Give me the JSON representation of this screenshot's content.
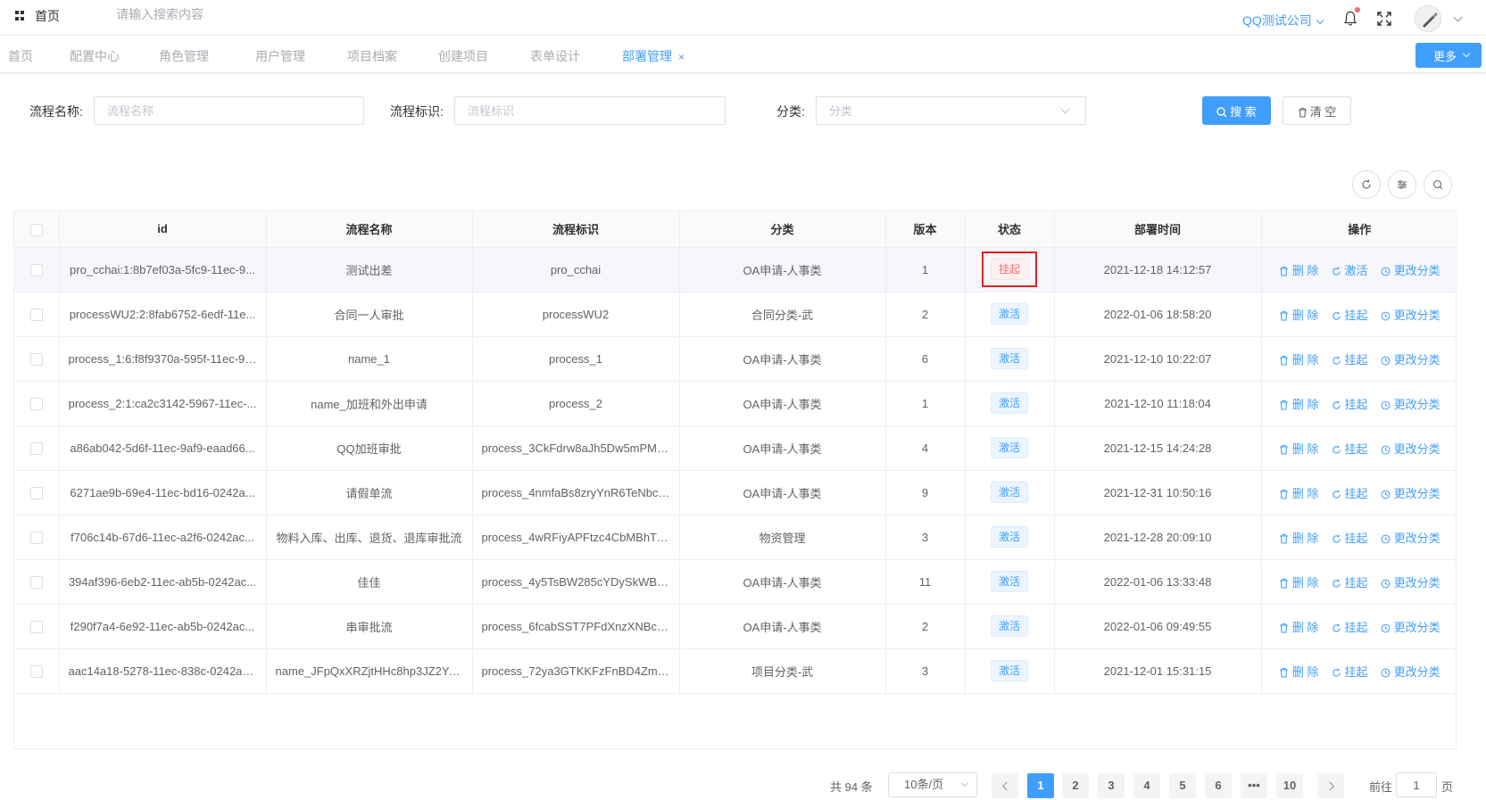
{
  "header": {
    "home_label": "首页",
    "search_placeholder": "请输入搜索内容",
    "company": "QQ测试公司"
  },
  "tabs": [
    {
      "label": "首页"
    },
    {
      "label": "配置中心"
    },
    {
      "label": "角色管理"
    },
    {
      "label": "用户管理"
    },
    {
      "label": "项目档案"
    },
    {
      "label": "创建项目"
    },
    {
      "label": "表单设计"
    },
    {
      "label": "部署管理",
      "active": true
    }
  ],
  "tab_close": "×",
  "more_label": "更多",
  "filters": {
    "name_label": "流程名称:",
    "name_placeholder": "流程名称",
    "key_label": "流程标识:",
    "key_placeholder": "流程标识",
    "category_label": "分类:",
    "category_placeholder": "分类",
    "search_label": "搜 索",
    "clear_label": "清 空"
  },
  "table": {
    "columns": [
      "id",
      "流程名称",
      "流程标识",
      "分类",
      "版本",
      "状态",
      "部署时间",
      "操作"
    ],
    "op_delete": "删 除",
    "rows": [
      {
        "id": "pro_cchai:1:8b7ef03a-5fc9-11ec-9...",
        "name": "测试出差",
        "key": "pro_cchai",
        "category": "OA申请-人事类",
        "version": "1",
        "status": "挂起",
        "toggle": "激活",
        "time": "2021-12-18 14:12:57",
        "change": "更改分类"
      },
      {
        "id": "processWU2:2:8fab6752-6edf-11e...",
        "name": "合同一人审批",
        "key": "processWU2",
        "category": "合同分类-武",
        "version": "2",
        "status": "激活",
        "toggle": "挂起",
        "time": "2022-01-06 18:58:20",
        "change": "更改分类"
      },
      {
        "id": "process_1:6:f8f9370a-595f-11ec-9c...",
        "name": "name_1",
        "key": "process_1",
        "category": "OA申请-人事类",
        "version": "6",
        "status": "激活",
        "toggle": "挂起",
        "time": "2021-12-10 10:22:07",
        "change": "更改分类"
      },
      {
        "id": "process_2:1:ca2c3142-5967-11ec-...",
        "name": "name_加班和外出申请",
        "key": "process_2",
        "category": "OA申请-人事类",
        "version": "1",
        "status": "激活",
        "toggle": "挂起",
        "time": "2021-12-10 11:18:04",
        "change": "更改分类"
      },
      {
        "id": "a86ab042-5d6f-11ec-9af9-eaad66...",
        "name": "QQ加班审批",
        "key": "process_3CkFdrw8aJh5Dw5mPME...",
        "category": "OA申请-人事类",
        "version": "4",
        "status": "激活",
        "toggle": "挂起",
        "time": "2021-12-15 14:24:28",
        "change": "更改分类"
      },
      {
        "id": "6271ae9b-69e4-11ec-bd16-0242a...",
        "name": "请假单流",
        "key": "process_4nmfaBs8zryYnR6TeNbck...",
        "category": "OA申请-人事类",
        "version": "9",
        "status": "激活",
        "toggle": "挂起",
        "time": "2021-12-31 10:50:16",
        "change": "更改分类"
      },
      {
        "id": "f706c14b-67d6-11ec-a2f6-0242ac...",
        "name": "物料入库、出库、退货、退库审批流",
        "key": "process_4wRFiyAPFtzc4CbMBhTiz...",
        "category": "物资管理",
        "version": "3",
        "status": "激活",
        "toggle": "挂起",
        "time": "2021-12-28 20:09:10",
        "change": "更改分类"
      },
      {
        "id": "394af396-6eb2-11ec-ab5b-0242ac...",
        "name": "佳佳",
        "key": "process_4y5TsBW285cYDySkWBfd...",
        "category": "OA申请-人事类",
        "version": "11",
        "status": "激活",
        "toggle": "挂起",
        "time": "2022-01-06 13:33:48",
        "change": "更改分类"
      },
      {
        "id": "f290f7a4-6e92-11ec-ab5b-0242ac...",
        "name": "串审批流",
        "key": "process_6fcabSST7PFdXnzXNBcj68...",
        "category": "OA申请-人事类",
        "version": "2",
        "status": "激活",
        "toggle": "挂起",
        "time": "2022-01-06 09:49:55",
        "change": "更改分类"
      },
      {
        "id": "aac14a18-5278-11ec-838c-0242ac...",
        "name": "name_JFpQxXRZjtHHc8hp3JZ2Ypx...",
        "key": "process_72ya3GTKKFzFnBD4ZmbA...",
        "category": "项目分类-武",
        "version": "3",
        "status": "激活",
        "toggle": "挂起",
        "time": "2021-12-01 15:31:15",
        "change": "更改分类"
      }
    ]
  },
  "pagination": {
    "total": "共 94 条",
    "page_size": "10条/页",
    "pages": [
      "1",
      "2",
      "3",
      "4",
      "5",
      "6",
      "•••",
      "10"
    ],
    "goto_label": "前往",
    "goto_value": "1",
    "goto_unit": "页"
  },
  "colors": {
    "primary": "#409eff",
    "danger": "#f56c6c",
    "highlight": "#e02020"
  }
}
